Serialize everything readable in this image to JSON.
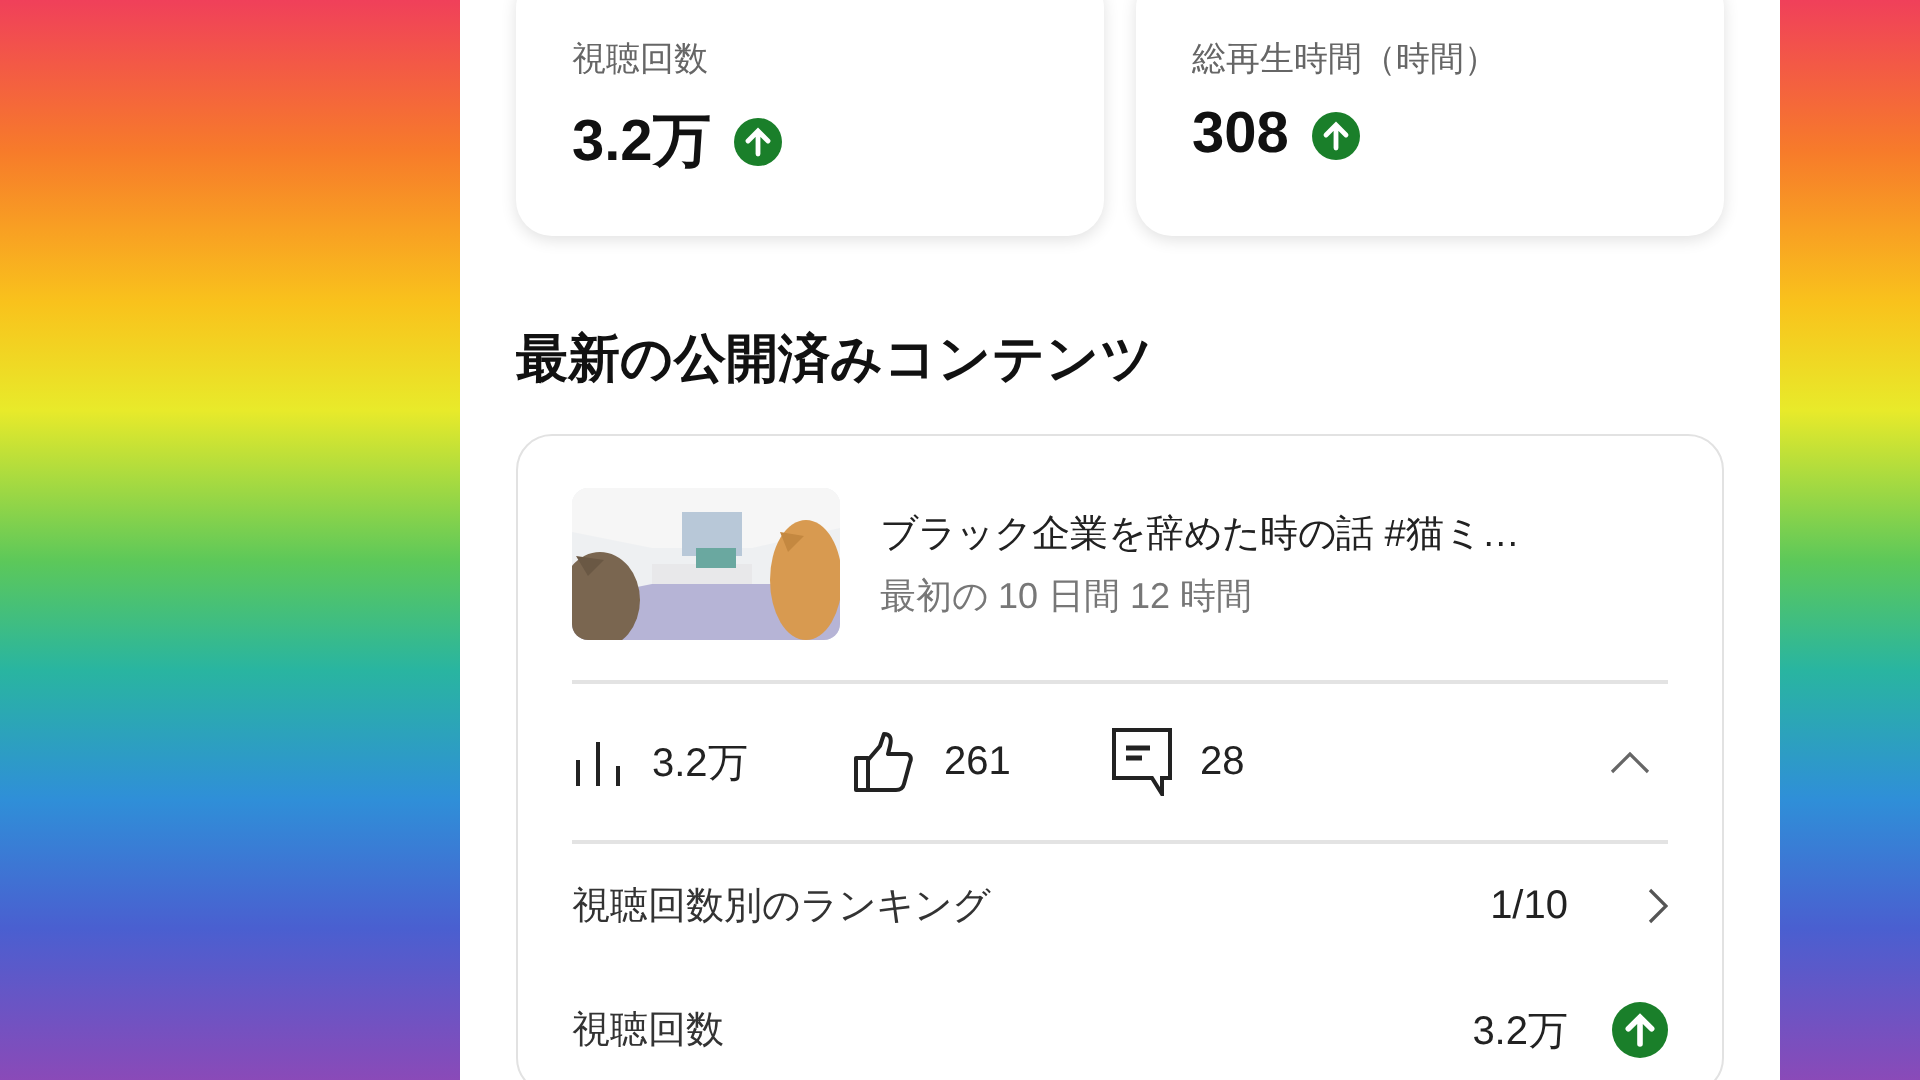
{
  "summary_cards": [
    {
      "label": "視聴回数",
      "value": "3.2万",
      "rising": true
    },
    {
      "label": "総再生時間（時間）",
      "value": "308",
      "rising": true
    }
  ],
  "section_title": "最新の公開済みコンテンツ",
  "latest_video": {
    "title": "ブラック企業を辞めた時の話 #猫ミ…",
    "period": "最初の 10 日間 12 時間",
    "stats": [
      {
        "kind": "views",
        "value": "3.2万"
      },
      {
        "kind": "likes",
        "value": "261"
      },
      {
        "kind": "comments",
        "value": "28"
      }
    ],
    "expanded": true,
    "rows": [
      {
        "label": "視聴回数別のランキング",
        "value": "1/10",
        "kind": "link"
      },
      {
        "label": "視聴回数",
        "value": "3.2万",
        "kind": "trend",
        "rising": true
      }
    ]
  }
}
